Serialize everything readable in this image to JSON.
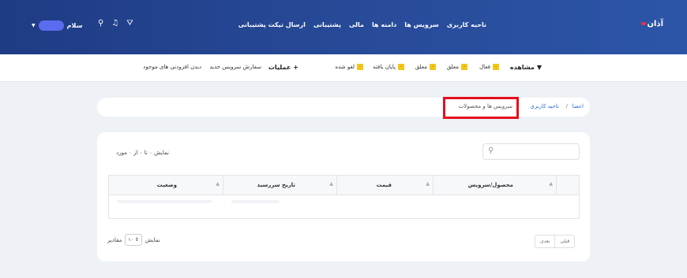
{
  "header": {
    "logo": "آذان",
    "nav": [
      "ناحیه کاربری",
      "سرویس ها",
      "دامنه ها",
      "مالی",
      "پشتیبانی",
      "ارسال تیکت پشتیبانی"
    ],
    "user_greeting": "سلام",
    "icons": [
      "cart-icon",
      "bell-icon",
      "search-icon"
    ]
  },
  "filterbar": {
    "view_label": "مشاهده",
    "filters": [
      {
        "label": "فعال",
        "count": "۰"
      },
      {
        "label": "معلق",
        "count": "۰"
      },
      {
        "label": "معلق",
        "count": "۰"
      },
      {
        "label": "پایان یافته",
        "count": "۰"
      },
      {
        "label": "لغو شده",
        "count": "۰"
      }
    ],
    "actions_label": "عملیات",
    "new_service": "سفارش سرویس جدید",
    "addons": "دیدن افزودنی های موجود"
  },
  "breadcrumb": {
    "home": "اعضا",
    "sep": "/",
    "client_area": "ناحیه کاربری",
    "current": "سرویس ها و محصولات"
  },
  "table": {
    "search_placeholder": "",
    "info": "نمایش ۰ تا ۰ از ۰ مورد",
    "columns": [
      "محصول/سرویس",
      "قیمت",
      "تاریخ سررسید",
      "وضعیت"
    ],
    "pager": {
      "prev": "قبلی",
      "next": "بعدی"
    },
    "page_size_label_show": "نمایش",
    "page_size_value": "۱۰",
    "page_size_label_items": "مقادیر"
  }
}
